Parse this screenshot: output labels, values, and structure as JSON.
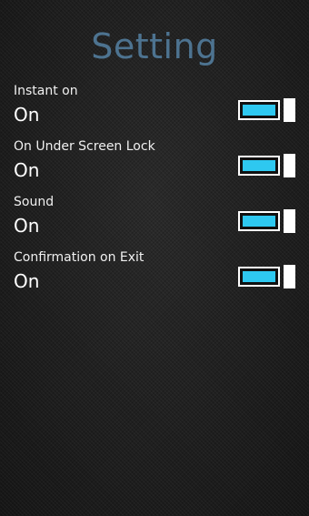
{
  "title": "Setting",
  "accent_color": "#2ec8f0",
  "title_color": "#4d7390",
  "settings": [
    {
      "label": "Instant on",
      "value": "On",
      "enabled": true
    },
    {
      "label": "On Under Screen Lock",
      "value": "On",
      "enabled": true
    },
    {
      "label": "Sound",
      "value": "On",
      "enabled": true
    },
    {
      "label": "Confirmation on Exit",
      "value": "On",
      "enabled": true
    }
  ]
}
